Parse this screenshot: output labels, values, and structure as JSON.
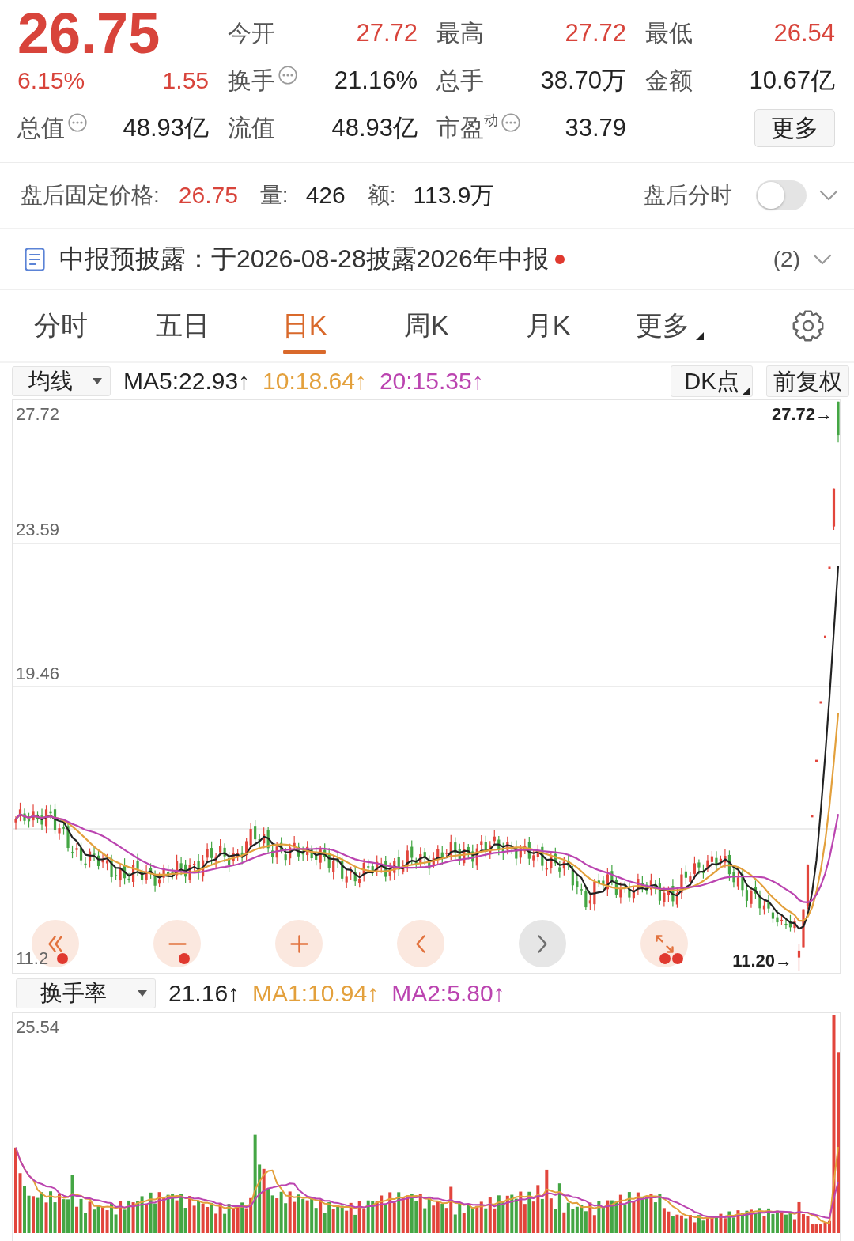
{
  "quote": {
    "price": "26.75",
    "rising": true,
    "change_percent": "6.15%",
    "change": "1.55",
    "stats": [
      {
        "label": "今开",
        "value": "27.72",
        "color": "#d8443b",
        "info_icon": false
      },
      {
        "label": "最高",
        "value": "27.72",
        "color": "#d8443b",
        "info_icon": false
      },
      {
        "label": "最低",
        "value": "26.54",
        "color": "#d8443b",
        "info_icon": false
      },
      {
        "label": "换手",
        "value": "21.16%",
        "color": "#222222",
        "info_icon": true
      },
      {
        "label": "总手",
        "value": "38.70万",
        "color": "#222222",
        "info_icon": false
      },
      {
        "label": "金额",
        "value": "10.67亿",
        "color": "#222222",
        "info_icon": false
      },
      {
        "label": "总值",
        "value": "48.93亿",
        "color": "#222222",
        "info_icon": true
      },
      {
        "label": "流值",
        "value": "48.93亿",
        "color": "#222222",
        "info_icon": false
      },
      {
        "label": "市盈$^{动}$",
        "value": "33.79",
        "color": "#222222",
        "info_icon": true
      }
    ],
    "more_button": "更多"
  },
  "after_hours": {
    "label": "盘后固定价格:",
    "price": "26.75",
    "volume_label": "量:",
    "volume": "426",
    "amount_label": "额:",
    "amount": "113.9万",
    "intraday_label": "盘后分时",
    "intraday_on": false,
    "expanded": false
  },
  "notice": {
    "text": "中报预披露：于2026-08-28披露2026年中报",
    "unread": true,
    "count": "(2)",
    "expanded": false
  },
  "period_tabs": [
    {
      "label": "分时",
      "selected": false,
      "kind": "tab"
    },
    {
      "label": "五日",
      "selected": false,
      "kind": "tab"
    },
    {
      "label": "日K",
      "selected": true,
      "kind": "tab"
    },
    {
      "label": "周K",
      "selected": false,
      "kind": "tab"
    },
    {
      "label": "月K",
      "selected": false,
      "kind": "tab"
    },
    {
      "label": "更多",
      "selected": false,
      "kind": "menu"
    }
  ],
  "main_chart": {
    "indicator": "均线",
    "legend": [
      {
        "text": "MA5:22.93↑",
        "color": "#222222"
      },
      {
        "text": "10:18.64↑",
        "color": "#e3a03c"
      },
      {
        "text": "20:15.35↑",
        "color": "#bb44b0"
      }
    ],
    "options": [
      {
        "label": "DK点",
        "menu": true
      },
      {
        "label": "前复权",
        "menu": false
      }
    ],
    "y_labels": [
      "27.72",
      "23.59",
      "19.46",
      "11.2"
    ],
    "high_marker": "27.72→",
    "low_marker": "11.20→",
    "controls": [
      {
        "kind": "rewind",
        "disabled": false,
        "dot": true,
        "double_dot": false
      },
      {
        "kind": "zoom_out",
        "disabled": false,
        "dot": true,
        "double_dot": false
      },
      {
        "kind": "zoom_in",
        "disabled": false,
        "dot": false,
        "double_dot": false
      },
      {
        "kind": "back",
        "disabled": false,
        "dot": false,
        "double_dot": false
      },
      {
        "kind": "forward",
        "disabled": true,
        "dot": false,
        "double_dot": false
      },
      {
        "kind": "fullscreen",
        "disabled": false,
        "dot": false,
        "double_dot": true
      }
    ]
  },
  "turnover_chart": {
    "indicator": "换手率",
    "legend": [
      {
        "text": "21.16↑",
        "color": "#222222"
      },
      {
        "text": "MA1:10.94↑",
        "color": "#e3a03c"
      },
      {
        "text": "MA2:5.80↑",
        "color": "#bb44b0"
      }
    ],
    "y_labels": [
      "25.54"
    ]
  }
}
